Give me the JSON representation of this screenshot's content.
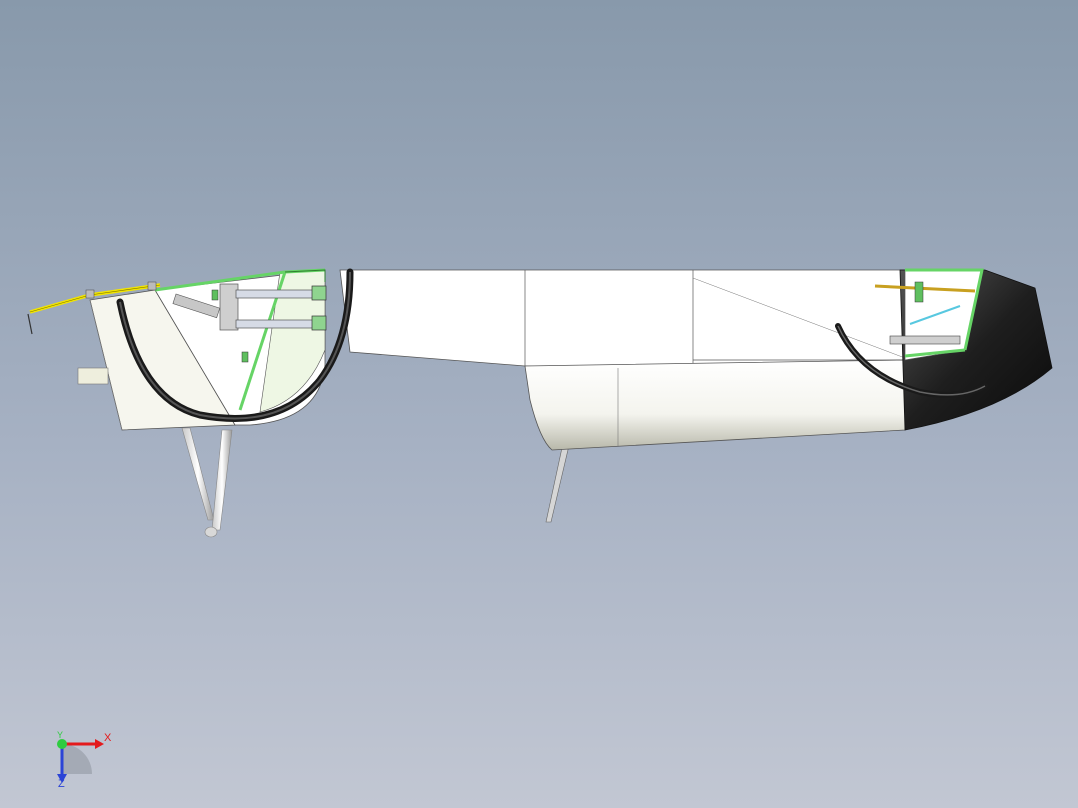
{
  "viewport": {
    "background_top": "#8899ab",
    "background_bottom": "#c2c7d3"
  },
  "model": {
    "body_color": "#ffffff",
    "frame_color": "#66d466",
    "hose_color": "#2a2a2a",
    "rail_color": "#f2e500",
    "nose_color": "#1e1e1e"
  },
  "triad": {
    "x_label": "X",
    "y_label": "Y",
    "z_label": "Z",
    "x_color": "#e41a1c",
    "y_color": "#2ecc40",
    "z_color": "#2b44d6"
  }
}
